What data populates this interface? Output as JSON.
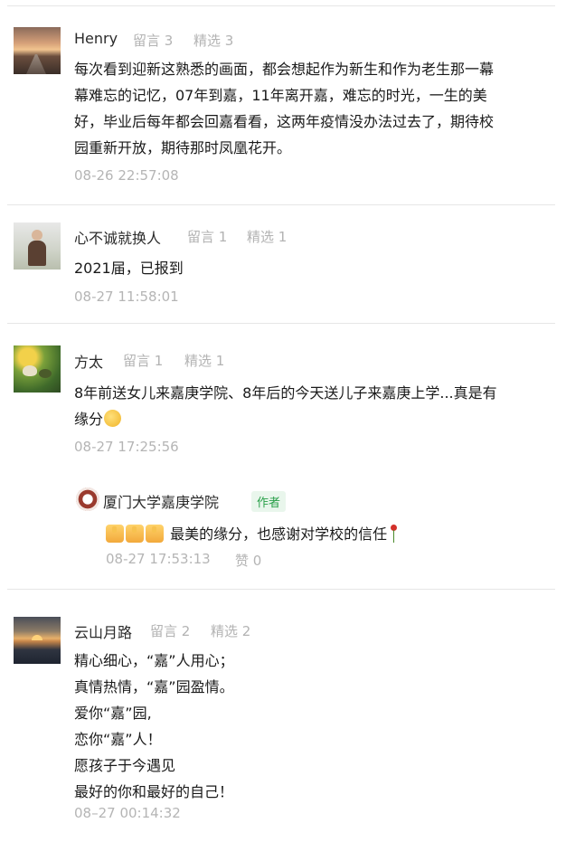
{
  "comments": [
    {
      "name": "Henry",
      "reply_count": "留言 3",
      "featured_count": "精选 3",
      "lines": [
        "每次看到迎新这熟悉的画面，都会想起作为新生和作为老生那一幕",
        "幕难忘的记忆，07年到嘉，11年离开嘉，难忘的时光，一生的美",
        "好，毕业后每年都会回嘉看看，这两年疫情没办法过去了，期待校",
        "园重新开放，期待那时凤凰花开。"
      ],
      "time": "08-26 22:57:08"
    },
    {
      "name": "心不诚就换人",
      "reply_count": "留言 1",
      "featured_count": "精选 1",
      "lines": [
        "2021届，已报到"
      ],
      "time": "08-27 11:58:01"
    },
    {
      "name": "方太",
      "reply_count": "留言 1",
      "featured_count": "精选 1",
      "lines": [
        "8年前送女儿来嘉庚学院、8年后的今天送儿子来嘉庚上学...真是有",
        "缘分"
      ],
      "time": "08-27 17:25:56",
      "reply": {
        "name": "厦门大学嘉庚学院",
        "tag": "作者",
        "text": "最美的缘分，也感谢对学校的信任",
        "time": "08-27 17:53:13",
        "likes": "赞 0"
      }
    },
    {
      "name": "云山月路",
      "reply_count": "留言 2",
      "featured_count": "精选 2",
      "lines": [
        "精心细心，“嘉”人用心；",
        "真情热情，“嘉”园盈情。",
        "爱你“嘉”园,",
        "恋你“嘉”人！",
        "愿孩子于今遇见",
        "最好的你和最好的自己！"
      ],
      "time": "08–27 00:14:32"
    }
  ],
  "icons": {
    "avatar_1": "sunset-road-avatar",
    "avatar_2": "person-avatar",
    "avatar_3": "bird-avatar",
    "avatar_4": "lake-sunset-avatar",
    "reply_logo": "university-logo-icon",
    "emoji_face": "grinning-face-icon",
    "thumbs": "thumbs-up-icon",
    "rose": "rose-icon"
  }
}
